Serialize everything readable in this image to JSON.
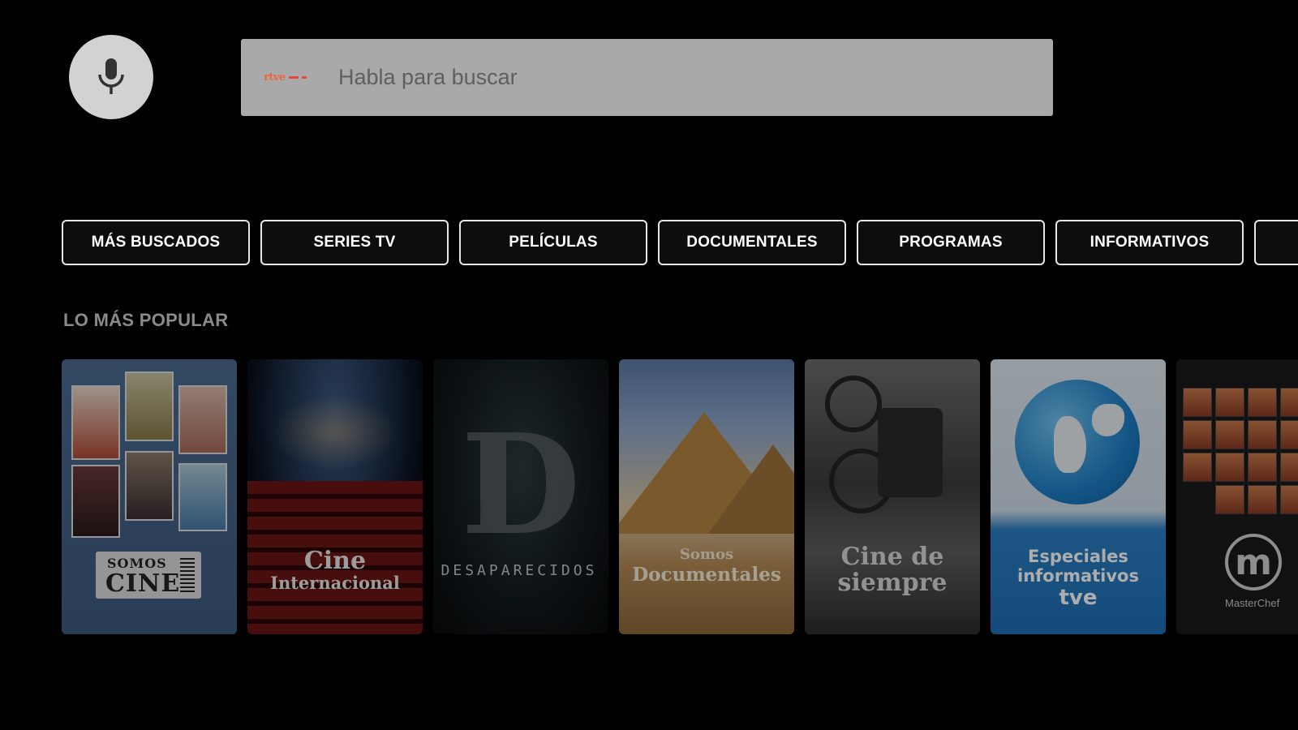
{
  "search": {
    "placeholder": "Habla para buscar",
    "logo_text": "rtve",
    "mic_icon": "microphone-icon"
  },
  "categories": [
    {
      "label": "MÁS BUSCADOS"
    },
    {
      "label": "SERIES TV"
    },
    {
      "label": "PELÍCULAS"
    },
    {
      "label": "DOCUMENTALES"
    },
    {
      "label": "PROGRAMAS"
    },
    {
      "label": "INFORMATIVOS"
    }
  ],
  "section": {
    "title": "LO MÁS POPULAR"
  },
  "cards": [
    {
      "line1": "SOMOS",
      "line2": "CINE"
    },
    {
      "line1": "Cine",
      "line2": "Internacional"
    },
    {
      "line1": "D",
      "line2": "DESAPARECIDOS"
    },
    {
      "line1": "Somos",
      "line2": "Documentales"
    },
    {
      "line1": "Cine de",
      "line2": "siempre"
    },
    {
      "line1": "Especiales",
      "line2": "informativos",
      "line3": "tve"
    },
    {
      "line1": "m",
      "line2": "MasterChef"
    }
  ],
  "colors": {
    "background": "#000000",
    "search_bg": "#a9a9a9",
    "mic_bg": "#d2d2d2",
    "tab_border": "#e6e6e6",
    "section_title": "#8b8b8b"
  }
}
